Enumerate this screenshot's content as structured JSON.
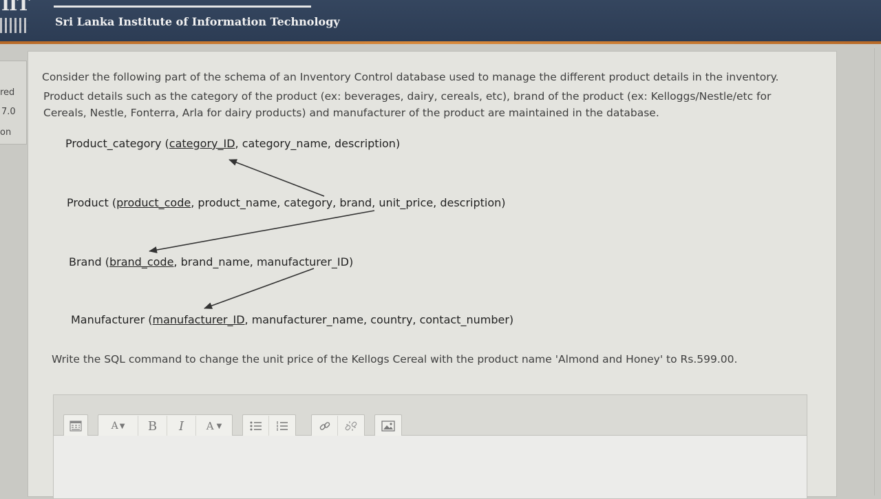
{
  "header": {
    "logo_text": "IIT",
    "institute_name": "Sri Lanka Institute of Information Technology"
  },
  "left_nav": {
    "fragments": [
      "red",
      "7.0",
      "on"
    ]
  },
  "question": {
    "intro": "Consider the following part of the schema of an Inventory Control database used to manage the different product details in the inventory.",
    "detail_line_1": "Product details such as the category of the product (ex: beverages, dairy, cereals, etc), brand of the product (ex: Kelloggs/Nestle/etc for",
    "detail_line_2": "Cereals, Nestle, Fonterra, Arla for dairy products) and manufacturer of the product are maintained in the database.",
    "schema": {
      "product_category": {
        "name": "Product_category",
        "key": "category_ID",
        "rest": ", category_name, description)"
      },
      "product": {
        "name": "Product",
        "key": "product_code",
        "rest": ", product_name, category, brand, unit_price, description)"
      },
      "brand": {
        "name": "Brand",
        "key": "brand_code",
        "rest": ", brand_name, manufacturer_ID)"
      },
      "manufacturer": {
        "name": "Manufacturer",
        "key": "manufacturer_ID",
        "rest": ", manufacturer_name, country, contact_number)"
      }
    },
    "task": "Write the SQL command to change the unit price of the Kellogs Cereal with the product name 'Almond and Honey' to Rs.599.00."
  },
  "editor": {
    "toolbar": {
      "toggle_icon": "toolbar-toggle-icon",
      "font_size": "A",
      "bold": "B",
      "italic": "I",
      "font_color": "A",
      "unordered_list_icon": "unordered-list-icon",
      "ordered_list_icon": "ordered-list-icon",
      "link_icon": "link-icon",
      "unlink_icon": "unlink-icon",
      "image_icon": "image-icon"
    },
    "content": ""
  }
}
